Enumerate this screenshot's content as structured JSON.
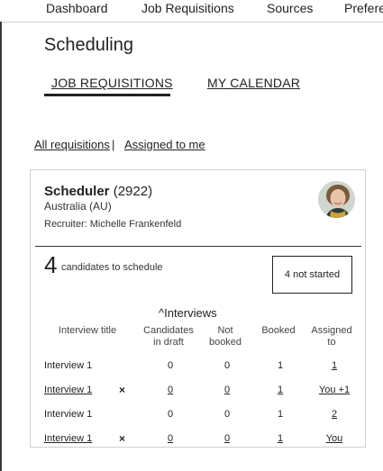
{
  "nav": {
    "items": [
      {
        "label": "Dashboard"
      },
      {
        "label": "Job Requisitions"
      },
      {
        "label": "Sources"
      },
      {
        "label": "Prefere"
      }
    ]
  },
  "page": {
    "title": "Scheduling",
    "tabs": [
      {
        "label": "JOB REQUISITIONS",
        "active": true
      },
      {
        "label": "MY CALENDAR",
        "active": false
      }
    ],
    "filters": {
      "all": "All requisitions",
      "separator": "|",
      "assigned": "Assigned to me"
    }
  },
  "card": {
    "title_bold": "Scheduler",
    "title_id": "(2922)",
    "country": "Australia (AU)",
    "recruiter": "Recruiter: Michelle Frankenfeld",
    "candidates_count": "4",
    "candidates_text": "candidates to schedule",
    "status": "4 not started",
    "interviews_toggle": "^Interviews",
    "table": {
      "headers": {
        "title": "Interview title",
        "draft_line1": "Candidates",
        "draft_line2": "in draft",
        "notbooked_line1": "Not",
        "notbooked_line2": "booked",
        "booked": "Booked",
        "assigned_line1": "Assigned",
        "assigned_line2": "to"
      },
      "rows": [
        {
          "title": "Interview 1",
          "draft": "0",
          "not_booked": "0",
          "booked": "1",
          "assigned": "1",
          "remove": ""
        },
        {
          "title": "Interview 1",
          "draft": "0",
          "not_booked": "0",
          "booked": "1",
          "assigned": "You +1",
          "remove": "×"
        },
        {
          "title": "Interview 1",
          "draft": "0",
          "not_booked": "0",
          "booked": "1",
          "assigned": "2",
          "remove": ""
        },
        {
          "title": "Interview 1",
          "draft": "0",
          "not_booked": "0",
          "booked": "1",
          "assigned": "You",
          "remove": "×"
        }
      ]
    }
  }
}
